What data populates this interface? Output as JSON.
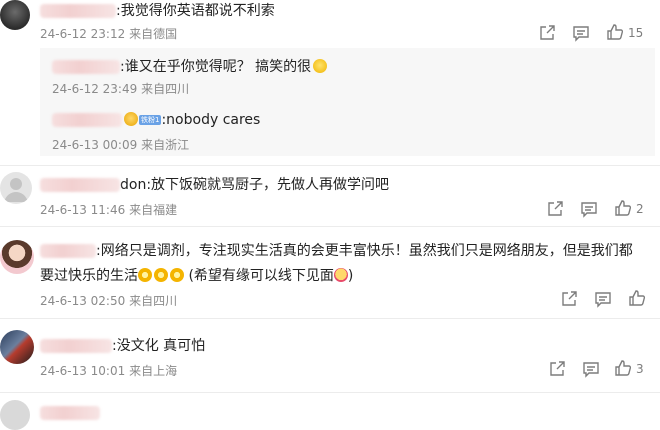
{
  "comments": [
    {
      "text": ":我觉得你英语都说不利索",
      "time": "24-6-12 23:12",
      "location": "来自德国",
      "likes": "15",
      "replies": [
        {
          "text": ":谁又在乎你觉得呢？ 搞笑的很",
          "time": "24-6-12 23:49",
          "location": "来自四川"
        },
        {
          "text": ":nobody cares",
          "time": "24-6-13 00:09",
          "location": "来自浙江"
        }
      ]
    },
    {
      "text": "don:放下饭碗就骂厨子，先做人再做学问吧",
      "time": "24-6-13 11:46",
      "location": "来自福建",
      "likes": "2"
    },
    {
      "text_line1": ":网络只是调剂，专注现实生活真的会更丰富快乐！虽然我们只是网络朋友，但是我们都",
      "text_line2a": "要过快乐的生活",
      "text_line2b": "(希望有缘可以线下见面",
      "text_line2c": ")",
      "time": "24-6-13 02:50",
      "location": "来自四川"
    },
    {
      "text": ":没文化 真可怕",
      "time": "24-6-13 10:01",
      "location": "来自上海",
      "likes": "3"
    }
  ],
  "badge": "铁粉1",
  "icons": [
    "share-icon",
    "comment-icon",
    "like-icon"
  ]
}
